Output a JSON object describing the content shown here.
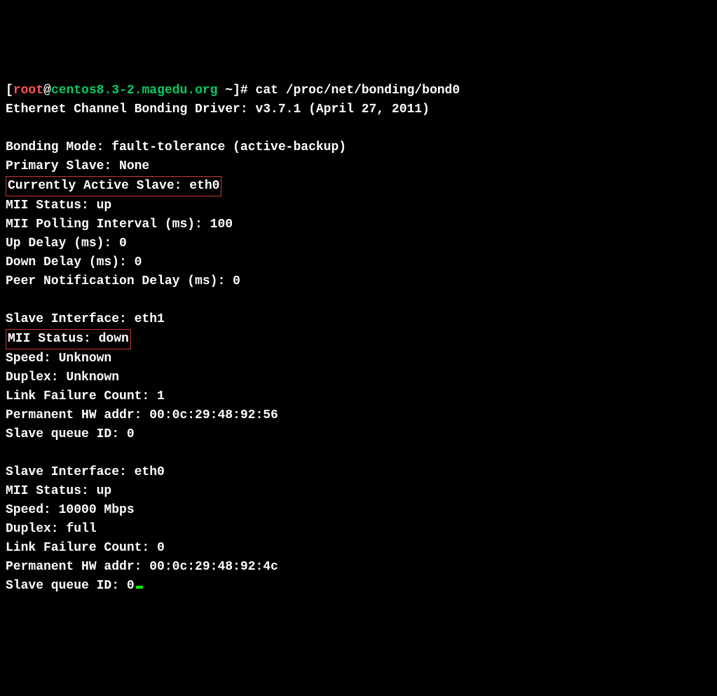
{
  "prompt": {
    "bracket_open": "[",
    "user": "root",
    "at": "@",
    "host": "centos8.3-2.magedu.org",
    "space_path": " ~",
    "bracket_close": "]",
    "hash": "# "
  },
  "command": "cat /proc/net/bonding/bond0",
  "lines": {
    "driver": "Ethernet Channel Bonding Driver: v3.7.1 (April 27, 2011)",
    "blank1": " ",
    "bonding_mode": "Bonding Mode: fault-tolerance (active-backup)",
    "primary_slave": "Primary Slave: None",
    "active_slave": "Currently Active Slave: eth0",
    "mii_status_main": "MII Status: up",
    "mii_polling": "MII Polling Interval (ms): 100",
    "up_delay": "Up Delay (ms): 0",
    "down_delay": "Down Delay (ms): 0",
    "peer_delay": "Peer Notification Delay (ms): 0",
    "blank2": " ",
    "slave1_iface": "Slave Interface: eth1",
    "slave1_mii": "MII Status: down",
    "slave1_speed": "Speed: Unknown",
    "slave1_duplex": "Duplex: Unknown",
    "slave1_linkfail": "Link Failure Count: 1",
    "slave1_hw": "Permanent HW addr: 00:0c:29:48:92:56",
    "slave1_queue": "Slave queue ID: 0",
    "blank3": " ",
    "slave0_iface": "Slave Interface: eth0",
    "slave0_mii": "MII Status: up",
    "slave0_speed": "Speed: 10000 Mbps",
    "slave0_duplex": "Duplex: full",
    "slave0_linkfail": "Link Failure Count: 0",
    "slave0_hw": "Permanent HW addr: 00:0c:29:48:92:4c",
    "slave0_queue": "Slave queue ID: 0"
  }
}
